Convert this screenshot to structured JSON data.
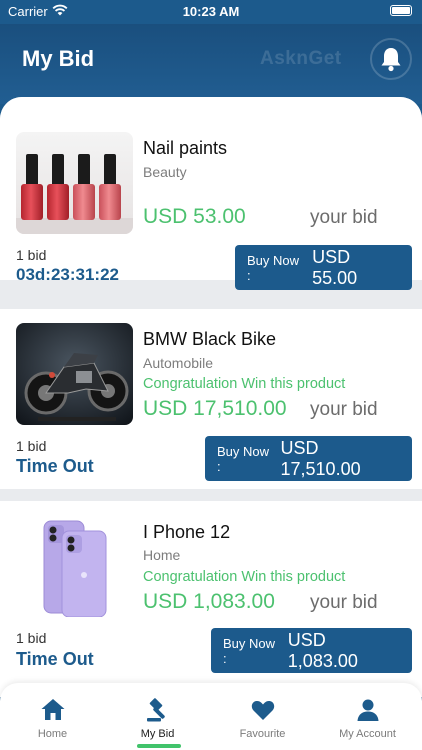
{
  "status_bar": {
    "carrier": "Carrier",
    "time": "10:23 AM"
  },
  "header": {
    "title": "My Bid",
    "brand": "AsknGet"
  },
  "bids": [
    {
      "name": "Nail paints",
      "category": "Beauty",
      "message": "",
      "price": "USD 53.00",
      "your_bid_label": "your bid",
      "bid_count": "1 bid",
      "status": "03d:23:31:22",
      "buy_label": "Buy Now :",
      "buy_price": "USD 55.00"
    },
    {
      "name": "BMW Black Bike",
      "category": "Automobile",
      "message": "Congratulation Win this product",
      "price": "USD 17,510.00",
      "your_bid_label": "your bid",
      "bid_count": "1 bid",
      "status": "Time Out",
      "buy_label": "Buy Now :",
      "buy_price": "USD 17,510.00"
    },
    {
      "name": "I Phone 12",
      "category": "Home",
      "message": "Congratulation Win this product",
      "price": "USD 1,083.00",
      "your_bid_label": "your bid",
      "bid_count": "1 bid",
      "status": "Time Out",
      "buy_label": "Buy Now :",
      "buy_price": "USD 1,083.00"
    }
  ],
  "nav": {
    "items": [
      {
        "label": "Home",
        "icon": "home-icon"
      },
      {
        "label": "My Bid",
        "icon": "gavel-icon"
      },
      {
        "label": "Favourite",
        "icon": "heart-icon"
      },
      {
        "label": "My Account",
        "icon": "person-icon"
      }
    ],
    "active": "My Bid"
  },
  "colors": {
    "primary": "#1c5a8c",
    "accent_green": "#4cc16f",
    "background": "#e9ebee"
  }
}
